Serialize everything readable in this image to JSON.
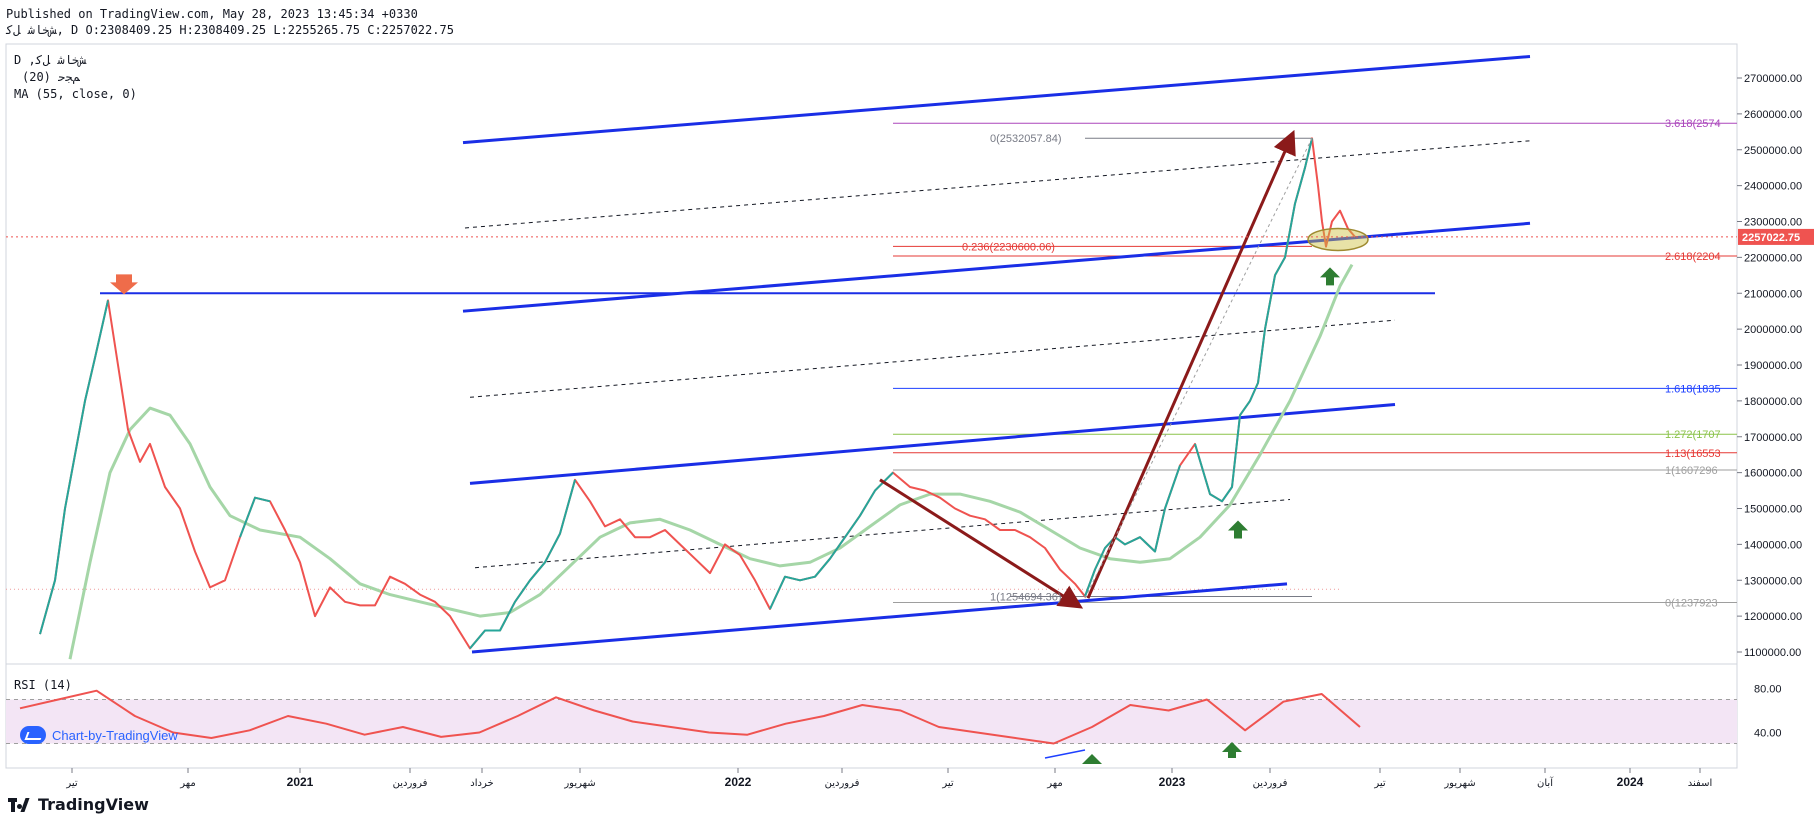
{
  "header": {
    "published": "Published on TradingView.com, May 28, 2023 13:45:34 +0330",
    "ohlc": "ﺶﺧﺎﺷ ﻞﮐ, D O:2308409.25 H:2308409.25 L:2255265.75 C:2257022.75"
  },
  "legend": {
    "symbol": "ﺶﺧﺎﺷ ﻞﮐ, D",
    "indicator1": "(20) ﻢﺠﺣ",
    "indicator2": "MA (55, close, 0)"
  },
  "rsi_label": "RSI (14)",
  "watermark": "Chart-by-TradingView",
  "brand": "TradingView",
  "colors": {
    "up": "#26a69a",
    "down": "#ef5350",
    "ma": "#a5d6a7",
    "channel": "#1a2ee6",
    "arrow": "#8b1a1a",
    "rsi": "#ef5350",
    "rsi_band": "#f3e5f5"
  },
  "chart_data": [
    {
      "type": "line",
      "name": "price",
      "x": [
        "2020-06",
        "2020-07",
        "2020-08",
        "2020-09",
        "2020-10",
        "2020-11",
        "2020-12",
        "2021-01",
        "2021-02",
        "2021-03",
        "2021-04",
        "2021-05",
        "2021-06",
        "2021-07",
        "2021-08",
        "2021-09",
        "2021-10",
        "2021-11",
        "2021-12",
        "2022-01",
        "2022-02",
        "2022-03",
        "2022-04",
        "2022-05",
        "2022-06",
        "2022-07",
        "2022-08",
        "2022-09",
        "2022-10",
        "2022-11",
        "2022-12",
        "2023-01",
        "2023-02",
        "2023-03",
        "2023-04",
        "2023-05"
      ],
      "series": [
        {
          "name": "",
          "values": [
            1100000,
            1700000,
            2050000,
            1650000,
            1450000,
            1250000,
            1450000,
            1500000,
            1350000,
            1250000,
            1300000,
            1200000,
            1150000,
            1350000,
            1550000,
            1450000,
            1400000,
            1350000,
            1300000,
            1250000,
            1350000,
            1450000,
            1550000,
            1600000,
            1480000,
            1420000,
            1350000,
            1280000,
            1300000,
            1400000,
            1400000,
            1650000,
            1550000,
            1850000,
            2200000,
            2257022.75
          ]
        },
        {
          "name": "",
          "values": [
            1050000,
            1500000,
            1780000,
            1700000,
            1550000,
            1400000,
            1380000,
            1380000,
            1350000,
            1320000,
            1290000,
            1260000,
            1240000,
            1260000,
            1300000,
            1380000,
            1440000,
            1450000,
            1420000,
            1380000,
            1350000,
            1360000,
            1400000,
            1460000,
            1520000,
            1540000,
            1500000,
            1420000,
            1350000,
            1320000,
            1330000,
            1420000,
            1550000,
            1750000,
            2000000,
            2180000
          ]
        }
      ],
      "ylim": [
        1050000,
        2800000
      ],
      "y_ticks": [
        "2700000.00",
        "2600000.00",
        "2500000.00",
        "2400000.00",
        "2300000.00",
        "2200000.00",
        "2100000.00",
        "2000000.00",
        "1900000.00",
        "1800000.00",
        "1700000.00",
        "1600000.00",
        "1500000.00",
        "1400000.00",
        "1300000.00",
        "1200000.00",
        "1100000.00"
      ],
      "x_tick_labels": [
        "تیر",
        "مهر",
        "2021",
        "فروردین",
        "خرداد",
        "شهریور",
        "2022",
        "فروردین",
        "تیر",
        "مهر",
        "2023",
        "فروردین",
        "تیر",
        "شهریور",
        "آبان",
        "2024",
        "اسفند"
      ],
      "last_price_label": "2257022.75",
      "fib_levels": [
        {
          "label": "3.618(2574",
          "value": 2574000,
          "color": "#ab47bc"
        },
        {
          "label": "2.618(2204",
          "value": 2204000,
          "color": "#e53935"
        },
        {
          "label": "1.618(1835",
          "value": 1835000,
          "color": "#1e40ff"
        },
        {
          "label": "1.272(1707",
          "value": 1707000,
          "color": "#8bc34a"
        },
        {
          "label": "1.13(16553",
          "value": 1655300,
          "color": "#e53935"
        },
        {
          "label": "1(1607296",
          "value": 1607296,
          "color": "#9e9e9e"
        },
        {
          "label": "0(1237923",
          "value": 1237923,
          "color": "#9e9e9e"
        }
      ],
      "retracement_labels": [
        {
          "label": "0(2532057.84)",
          "value": 2532057.84
        },
        {
          "label": "0.236(2230600.06)",
          "value": 2230600.06
        },
        {
          "label": "1(1254694.36)",
          "value": 1254694.36
        }
      ],
      "grid": false,
      "legend": "top-left"
    },
    {
      "type": "line",
      "name": "rsi",
      "title": "RSI (14)",
      "ylim": [
        20,
        100
      ],
      "y_ticks": [
        "80.00",
        "40.00"
      ],
      "band": [
        30,
        70
      ],
      "values": [
        62,
        70,
        78,
        55,
        40,
        35,
        42,
        55,
        48,
        38,
        45,
        36,
        40,
        55,
        72,
        60,
        50,
        45,
        40,
        38,
        48,
        55,
        65,
        60,
        45,
        40,
        35,
        30,
        45,
        65,
        60,
        70,
        42,
        68,
        75,
        45
      ]
    }
  ]
}
